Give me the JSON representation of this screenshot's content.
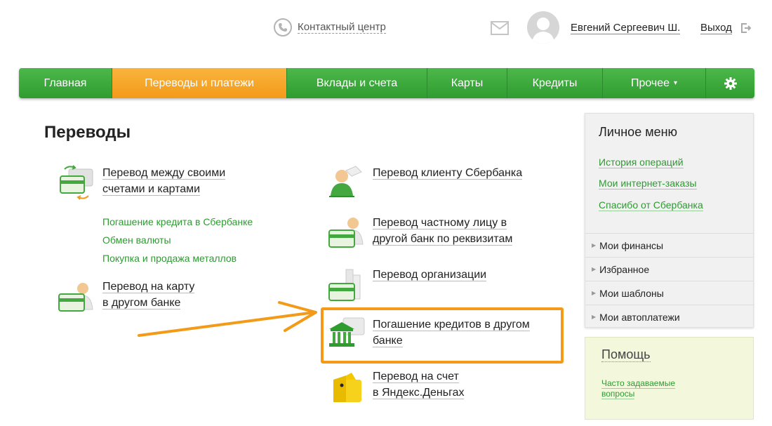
{
  "header": {
    "contact_label": "Контактный центр",
    "user_name": "Евгений Сергеевич Ш.",
    "logout_label": "Выход"
  },
  "nav": {
    "items": [
      {
        "label": "Главная"
      },
      {
        "label": "Переводы и платежи",
        "active": true
      },
      {
        "label": "Вклады и счета"
      },
      {
        "label": "Карты"
      },
      {
        "label": "Кредиты"
      },
      {
        "label": "Прочее"
      }
    ]
  },
  "main": {
    "title": "Переводы",
    "ops": [
      {
        "line1": "Перевод между своими",
        "line2": "счетами и картами",
        "icon": "own-accounts-transfer-icon"
      },
      {
        "line1": "Перевод на карту",
        "line2": "в другом банке",
        "icon": "card-other-bank-icon"
      },
      {
        "line1": "Перевод клиенту Сбербанка",
        "line2": "",
        "icon": "sber-client-icon"
      },
      {
        "line1": "Перевод частному лицу в",
        "line2": "другой банк по реквизитам",
        "icon": "private-person-icon"
      },
      {
        "line1": "Перевод организации",
        "line2": "",
        "icon": "organization-icon"
      },
      {
        "line1": "Погашение кредитов в другом",
        "line2": "банке",
        "icon": "bank-building-icon"
      },
      {
        "line1": "Перевод на счет",
        "line2": "в Яндекс.Деньгах",
        "icon": "yandex-wallet-icon"
      }
    ],
    "sublinks": [
      "Погашение кредита в Сбербанке",
      "Обмен валюты",
      "Покупка и продажа металлов"
    ]
  },
  "sidebar": {
    "title": "Личное меню",
    "links": [
      "История операций",
      "Мои интернет-заказы",
      "Спасибо от Сбербанка"
    ],
    "sections": [
      "Мои финансы",
      "Избранное",
      "Мои шаблоны",
      "Мои автоплатежи"
    ]
  },
  "help": {
    "title": "Помощь",
    "link": "Часто задаваемые вопросы"
  },
  "colors": {
    "nav_green": "#3aa83a",
    "nav_active_orange": "#f5a623",
    "link_green": "#2e9a31",
    "highlight_orange": "#f39a19"
  }
}
